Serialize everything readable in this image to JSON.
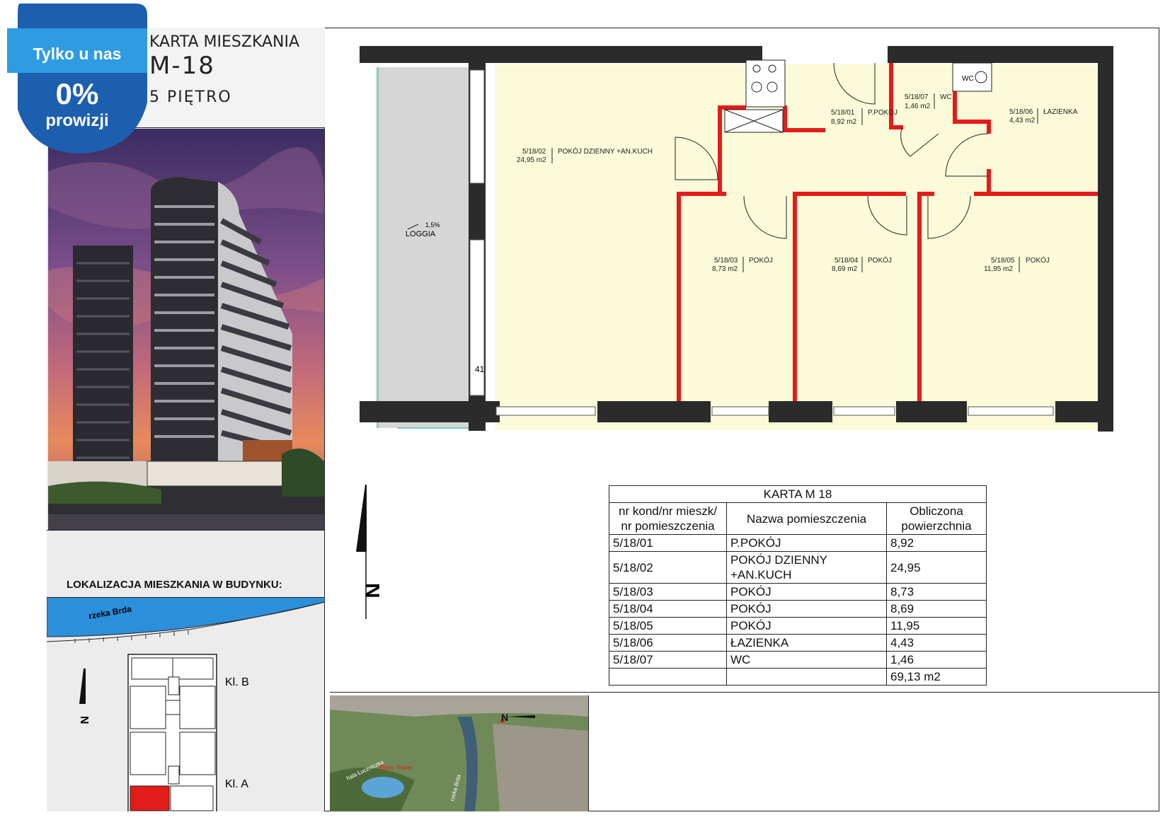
{
  "title": {
    "line1": "KARTA MIESZKANIA",
    "line2": "M-18",
    "line3": "5 PIĘTRO"
  },
  "badge": {
    "top": "Tylko u nas",
    "percent": "0%",
    "bottom": "prowizji",
    "color_light": "#2f9be3",
    "color_dark": "#1c5fae"
  },
  "location": {
    "label": "LOKALIZACJA MIESZKANIA W BUDYNKU:",
    "river": "rzeka Brda",
    "stair_b": "Kl. B",
    "stair_a": "Kl. A"
  },
  "plan": {
    "loggia": "LOGGIA",
    "slope": "1,5%",
    "column_mark": "41",
    "rooms": [
      {
        "code": "5/18/01",
        "name": "P.POKÓJ",
        "area": "8,92 m2"
      },
      {
        "code": "5/18/02",
        "name": "POKÓJ DZIENNY +AN.KUCH",
        "area": "24,95 m2"
      },
      {
        "code": "5/18/03",
        "name": "POKÓJ",
        "area": "8,73 m2"
      },
      {
        "code": "5/18/04",
        "name": "POKÓJ",
        "area": "8,69 m2"
      },
      {
        "code": "5/18/05",
        "name": "POKÓJ",
        "area": "11,95 m2"
      },
      {
        "code": "5/18/06",
        "name": "ŁAZIENKA",
        "area": "4,43 m2"
      },
      {
        "code": "5/18/07",
        "name": "WC",
        "area": "1,46 m2"
      }
    ],
    "wc_symbol": "WC"
  },
  "card": {
    "title": "KARTA M 18",
    "col1": "nr kond/nr mieszk/ nr pomieszczenia",
    "col2": "Nazwa pomieszczenia",
    "col3": "Obliczona powierzchnia",
    "rows": [
      [
        "5/18/01",
        "P.POKÓJ",
        "8,92"
      ],
      [
        "5/18/02",
        "POKÓJ DZIENNY +AN.KUCH",
        "24,95"
      ],
      [
        "5/18/03",
        "POKÓJ",
        "8,73"
      ],
      [
        "5/18/04",
        "POKÓJ",
        "8,69"
      ],
      [
        "5/18/05",
        "POKÓJ",
        "11,95"
      ],
      [
        "5/18/06",
        "ŁAZIENKA",
        "4,43"
      ],
      [
        "5/18/07",
        "WC",
        "1,46"
      ]
    ],
    "total": "69,13 m2"
  },
  "north": "N",
  "aerial": {
    "river": "rzeka Brda",
    "hall": "hala Łuczniczka",
    "tower": "River Tower"
  },
  "colors": {
    "room_fill": "#fbfbd9",
    "new_wall": "#e41b1b",
    "structure_wall": "#2b2b2b",
    "loggia": "#d6d6d6",
    "highlight_unit": "#e41b1b"
  }
}
